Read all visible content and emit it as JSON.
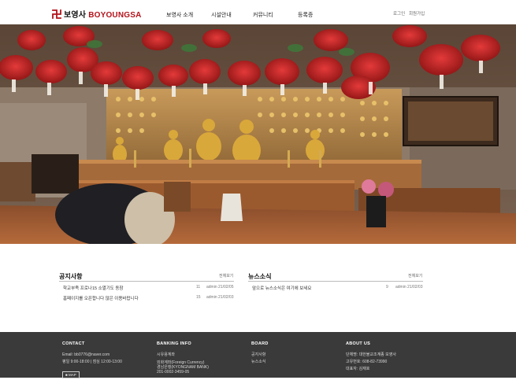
{
  "header": {
    "logo_text": "보영사",
    "logo_brand": "BOYOUNGSA",
    "nav": [
      "보영사 소개",
      "시설안내",
      "커뮤니티",
      "등록증"
    ],
    "login": "로그인",
    "signup": "회원가입"
  },
  "notice": {
    "title": "공지사항",
    "more": "전체보기",
    "posts": [
      {
        "title": "학교부족 프로나15 소멸기도 동참",
        "count": "11",
        "author_date": "admin 21/02/05"
      },
      {
        "title": "홈페이지를 오픈합니다 많은 이용바랍니다",
        "count": "15",
        "author_date": "admin 21/02/03"
      }
    ]
  },
  "news": {
    "title": "뉴스소식",
    "more": "전체보기",
    "posts": [
      {
        "title": "앞으로 뉴스소식은 여기에 보세요",
        "count": "9",
        "author_date": "admin 21/02/03"
      }
    ]
  },
  "footer": {
    "contact": {
      "title": "CONTACT",
      "lines": [
        "Email: bb0776@naver.com",
        "평일 9:00-18:00 | 점심 12:00-13:00"
      ],
      "badge": "■ MAP"
    },
    "banking": {
      "title": "BANKING INFO",
      "lines": [
        "시유용계좌",
        "외화계좌(Foreign Currency)",
        "경남은행(KYONGNAM BANK)",
        "201-0002-3459-05"
      ]
    },
    "board": {
      "title": "BOARD",
      "lines": [
        "공지사항",
        "뉴스소식"
      ]
    },
    "about": {
      "title": "ABOUT US",
      "lines": [
        "단체명: 대한불교조계종 보영사",
        "고유번호: 608-82-73990",
        "대표자: 김재호"
      ]
    }
  },
  "colors": {
    "brand": "#b3121a",
    "footer_bg": "#3a3a3a"
  }
}
